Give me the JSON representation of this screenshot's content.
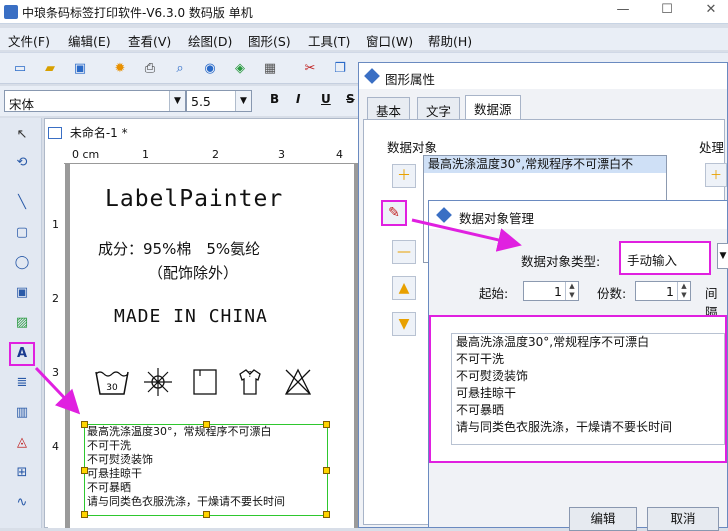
{
  "window": {
    "title": "中琅条码标签打印软件-V6.3.0 数码版 单机"
  },
  "menu": [
    "文件(F)",
    "编辑(E)",
    "查看(V)",
    "绘图(D)",
    "图形(S)",
    "工具(T)",
    "窗口(W)",
    "帮助(H)"
  ],
  "fontbar": {
    "font_name": "宋体",
    "font_size": "5.5",
    "bold": "B",
    "italic": "I",
    "underline": "U",
    "strike": "S"
  },
  "document": {
    "tab_title": "未命名-1 *",
    "ruler_unit": "0 cm",
    "ruler_marks": [
      "1",
      "2",
      "3",
      "4"
    ],
    "ruler_v_marks": [
      "1",
      "2",
      "3",
      "4"
    ],
    "label_title": "LabelPainter",
    "composition_line1": "成分：95%棉　5%氨纶",
    "composition_line2": "（配饰除外）",
    "origin": "MADE IN CHINA",
    "care_wash_temp": "30",
    "text_lines": [
      "最高洗涤温度30°，常规程序不可漂白",
      "不可干洗",
      "不可熨烫装饰",
      "可悬挂晾干",
      "不可暴晒",
      "请与同类色衣服洗涤，干燥请不要长时间"
    ]
  },
  "props_dialog": {
    "title": "图形属性",
    "tabs": [
      "基本",
      "文字",
      "数据源"
    ],
    "active_tab": "数据源",
    "data_object_label": "数据对象",
    "process_label": "处理",
    "data_object_item": "最高洗涤温度30°,常规程序不可漂白不"
  },
  "manage_dialog": {
    "title": "数据对象管理",
    "type_label": "数据对象类型:",
    "type_value": "手动输入",
    "start_label": "起始:",
    "start_value": "1",
    "copies_label": "份数:",
    "copies_value": "1",
    "interval_label": "间隔",
    "content_lines": [
      "最高洗涤温度30°,常规程序不可漂白",
      "不可干洗",
      "不可熨烫装饰",
      "可悬挂晾干",
      "不可暴晒",
      "请与同类色衣服洗涤，干燥请不要长时间"
    ],
    "edit_button": "编辑",
    "cancel_button": "取消"
  },
  "colors": {
    "highlight": "#e020e0",
    "selection": "#2ec72e",
    "accent": "#3a6fc4"
  }
}
